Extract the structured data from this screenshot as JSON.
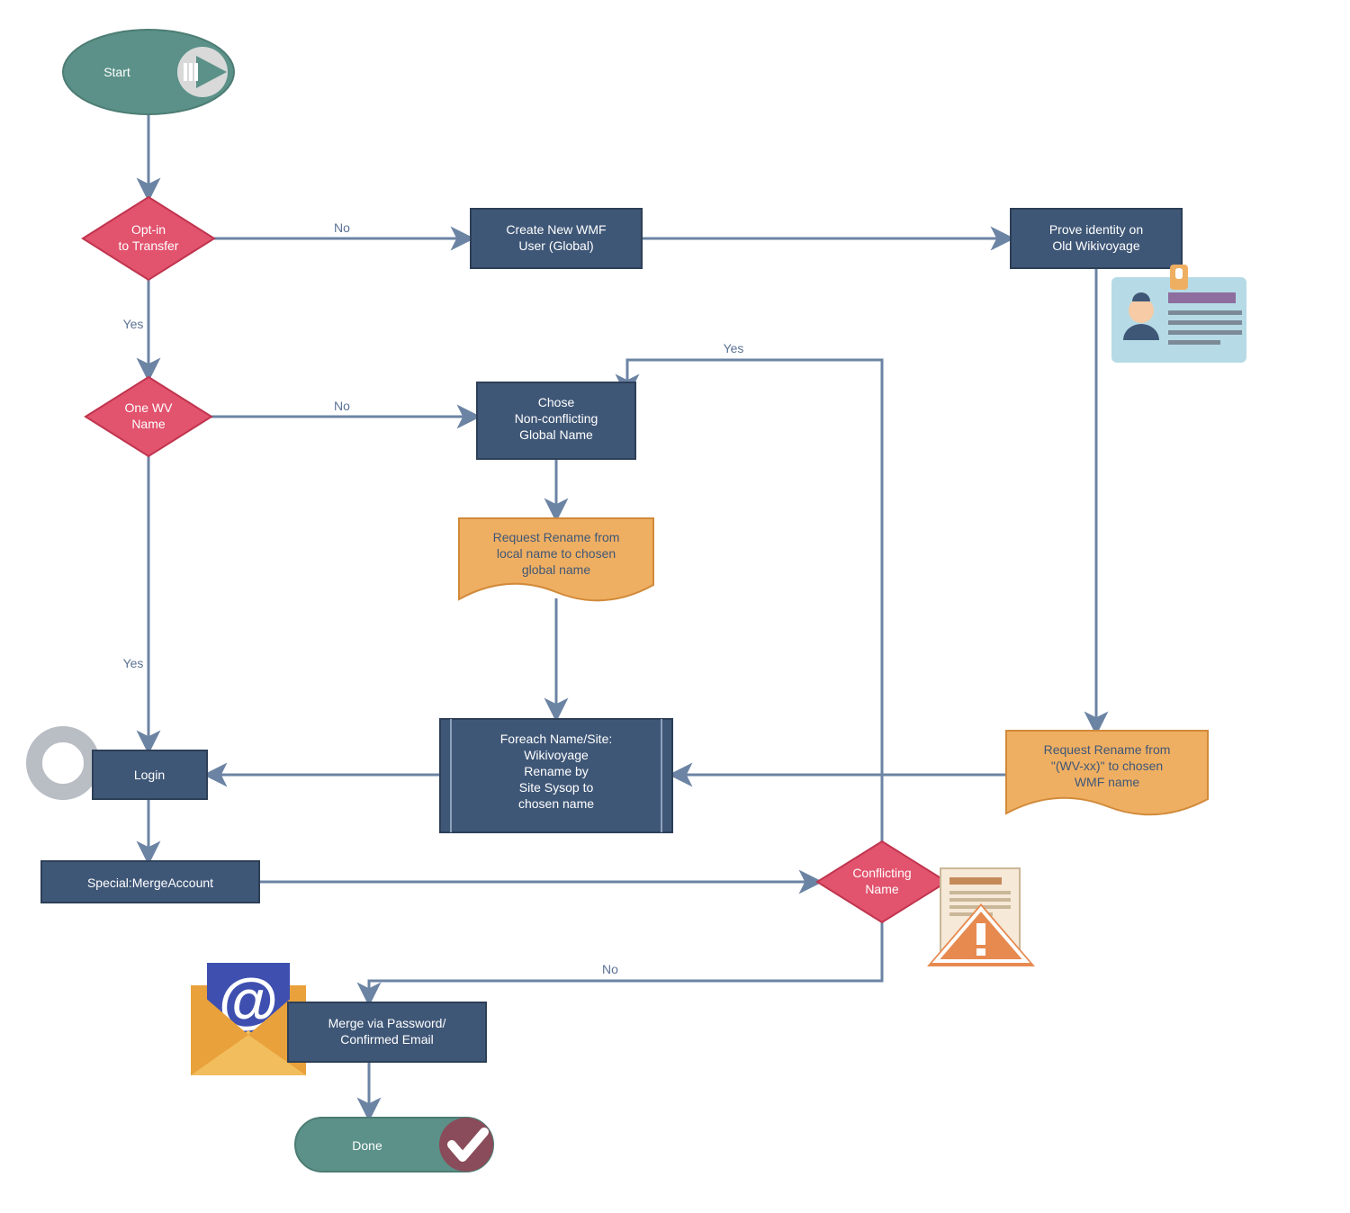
{
  "colors": {
    "process": "#3f5777",
    "decision": "#e2536e",
    "document": "#efaf62",
    "terminal_green": "#5b9188",
    "arrow": "#6c84a4",
    "edge_text": "#5b7294",
    "white": "#ffffff",
    "maroon": "#8a4c5a",
    "icon_grey": "#d0d4d9",
    "icon_grey_dark": "#9aa0a6",
    "orange": "#e78a50",
    "card_blue": "#b6dbe6",
    "card_navy": "#3f5777"
  },
  "start": {
    "label": "Start"
  },
  "done": {
    "label": "Done"
  },
  "decisions": {
    "optin": {
      "line1": "Opt-in",
      "line2": "to Transfer"
    },
    "onewv": {
      "line1": "One WV",
      "line2": "Name"
    },
    "conflict": {
      "line1": "Conflicting",
      "line2": "Name"
    }
  },
  "processes": {
    "create_wmf": {
      "line1": "Create New WMF",
      "line2": "User (Global)"
    },
    "prove_id": {
      "line1": "Prove identity on",
      "line2": "Old Wikivoyage"
    },
    "chose_name": {
      "line1": "Chose",
      "line2": "Non-conflicting",
      "line3": "Global Name"
    },
    "foreach": {
      "line1": "Foreach Name/Site:",
      "line2": "Wikivoyage",
      "line3": "Rename by",
      "line4": "Site Sysop to",
      "line5": "chosen name"
    },
    "login": {
      "label": "Login"
    },
    "merge_acct": {
      "label": "Special:MergeAccount"
    },
    "merge_email": {
      "line1": "Merge via Password/",
      "line2": "Confirmed Email"
    }
  },
  "documents": {
    "req_local": {
      "line1": "Request Rename from",
      "line2": "local name to chosen",
      "line3": "global name"
    },
    "req_wvxx": {
      "line1": "Request Rename from",
      "line2": "\"(WV-xx)\" to chosen",
      "line3": "WMF name"
    }
  },
  "edges": {
    "optin_no": "No",
    "optin_yes": "Yes",
    "onewv_no": "No",
    "onewv_yes": "Yes",
    "conflict_no": "No",
    "conflict_yes": "Yes"
  }
}
